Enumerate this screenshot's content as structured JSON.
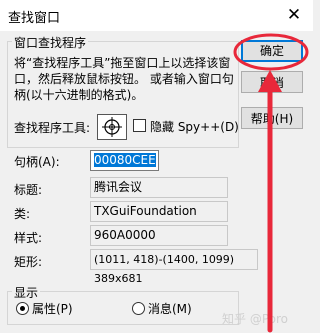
{
  "window": {
    "title": "查找窗口",
    "close_glyph": "✕"
  },
  "finder_group": {
    "label": "窗口查找程序",
    "description": "将“查找程序工具”拖至窗口上以选择该窗口，然后释放鼠标按钮。 或者输入窗口句柄(以十六进制的格式)。",
    "tool_label": "查找程序工具:",
    "hide_label": "隐藏 Spy++(D)"
  },
  "buttons": {
    "ok": "确定",
    "cancel": "取消",
    "help": "帮助(H)"
  },
  "fields": {
    "handle_label": "句柄(A):",
    "handle_value": "00080CEE",
    "caption_label": "标题:",
    "caption_value": "腾讯会议",
    "class_label": "类:",
    "class_value": "TXGuiFoundation",
    "style_label": "样式:",
    "style_value": "960A0000",
    "rect_label": "矩形:",
    "rect_value": "(1011, 418)-(1400, 1099) 389x681"
  },
  "show_group": {
    "label": "显示",
    "properties": "属性(P)",
    "messages": "消息(M)",
    "selected": "properties"
  },
  "annotation": {
    "arrow_color": "#e8283a"
  },
  "watermark": "知乎 @Poro"
}
